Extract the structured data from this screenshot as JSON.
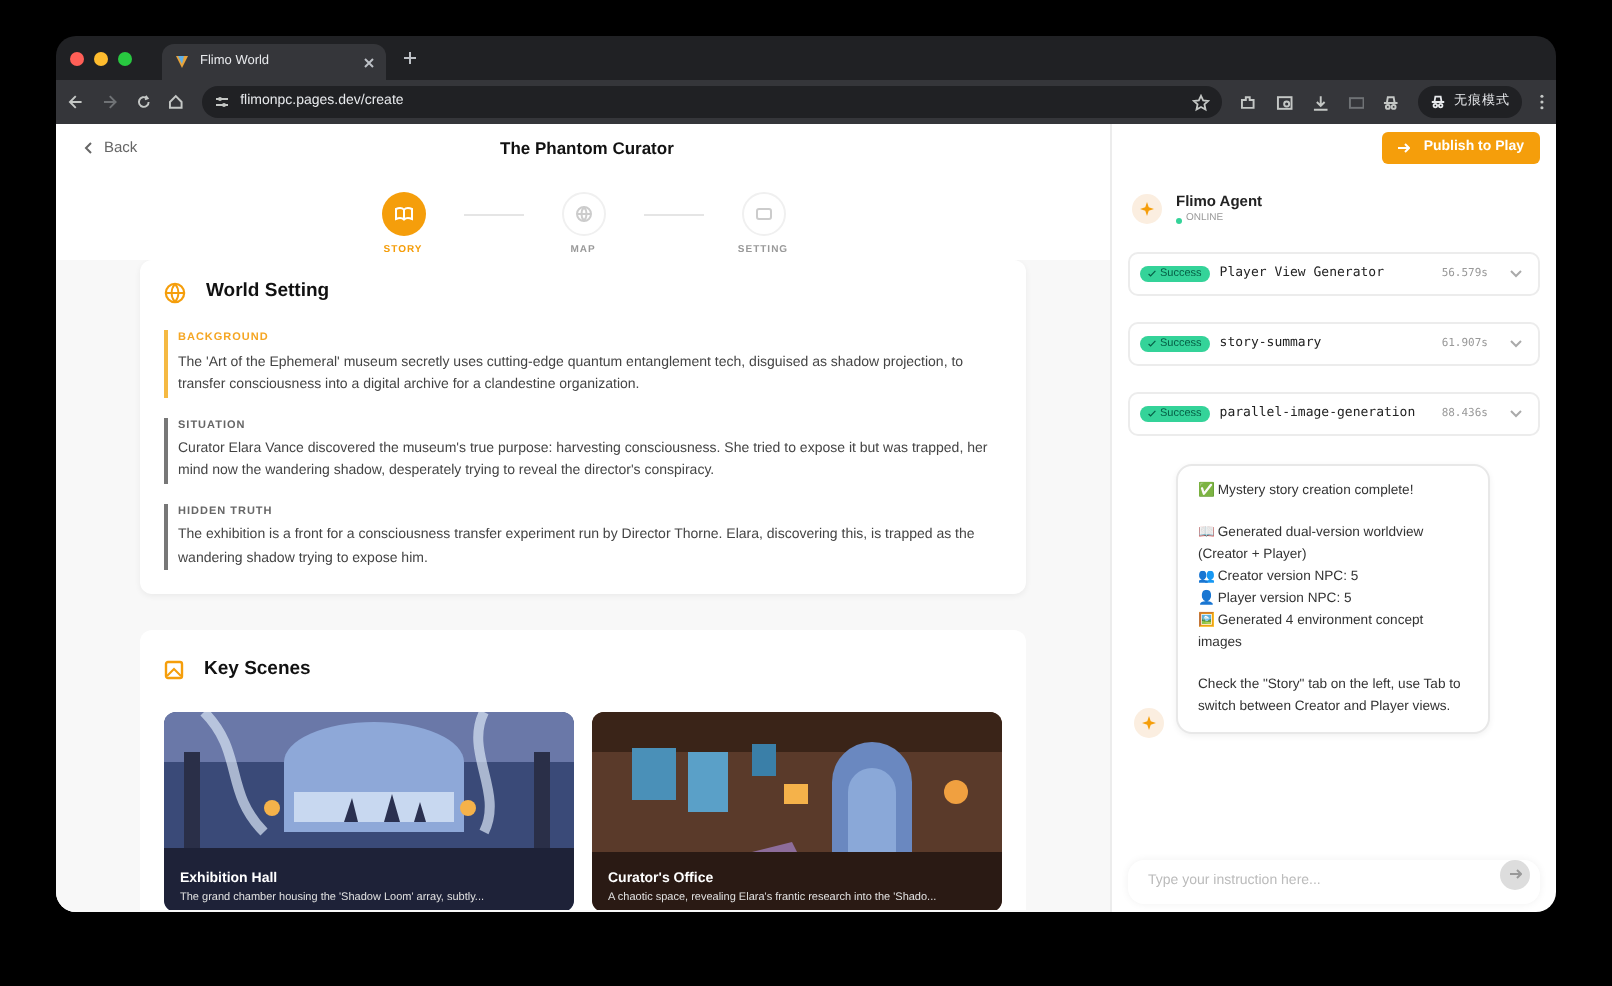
{
  "browser": {
    "tab_title": "Flimo World",
    "url": "flimonpc.pages.dev/create",
    "profile_label": "无痕模式"
  },
  "header": {
    "back_label": "Back",
    "title": "The Phantom Curator",
    "publish_label": "Publish to Play"
  },
  "steps": [
    {
      "label": "STORY",
      "kind": "book",
      "selected": true
    },
    {
      "label": "MAP",
      "kind": "globe",
      "selected": false
    },
    {
      "label": "SETTING",
      "kind": "window",
      "selected": false
    }
  ],
  "world_setting": {
    "title": "World Setting",
    "sections": [
      {
        "label": "BACKGROUND",
        "highlighted": true,
        "text": "The 'Art of the Ephemeral' museum secretly uses cutting-edge quantum entanglement tech, disguised as shadow projection, to transfer consciousness into a digital archive for a clandestine organization."
      },
      {
        "label": "SITUATION",
        "highlighted": false,
        "text": "Curator Elara Vance discovered the museum's true purpose: harvesting consciousness. She tried to expose it but was trapped, her mind now the wandering shadow, desperately trying to reveal the director's conspiracy."
      },
      {
        "label": "HIDDEN TRUTH",
        "highlighted": false,
        "text": "The exhibition is a front for a consciousness transfer experiment run by Director Thorne. Elara, discovering this, is trapped as the wandering shadow trying to expose him."
      }
    ]
  },
  "key_scenes": {
    "title": "Key Scenes",
    "scenes": [
      {
        "kind": "picture",
        "title": "Exhibition Hall",
        "caption": "The grand chamber housing the 'Shadow Loom' array, subtly..."
      },
      {
        "kind": "picture",
        "title": "Curator's Office",
        "caption": "A chaotic space, revealing Elara's frantic research into the 'Shado..."
      }
    ]
  },
  "agent": {
    "name": "Flimo Agent",
    "status": "ONLINE",
    "tasks": [
      {
        "status": "Success",
        "name": "Player View Generator",
        "duration": "56.579s"
      },
      {
        "status": "Success",
        "name": "story-summary",
        "duration": "61.907s"
      },
      {
        "status": "Success",
        "name": "parallel-image-generation",
        "duration": "88.436s"
      }
    ],
    "message": [
      [
        "✅ Mystery story creation complete!"
      ],
      [
        "📖 Generated dual-version worldview (Creator + Player)",
        "👥 Creator version NPC: 5",
        "👤 Player version NPC: 5",
        "🖼️ Generated 4 environment concept images"
      ],
      [
        "Check the \"Story\" tab on the left, use Tab to switch between Creator and Player views."
      ]
    ],
    "input": {
      "placeholder": "Type your instruction here..."
    }
  }
}
